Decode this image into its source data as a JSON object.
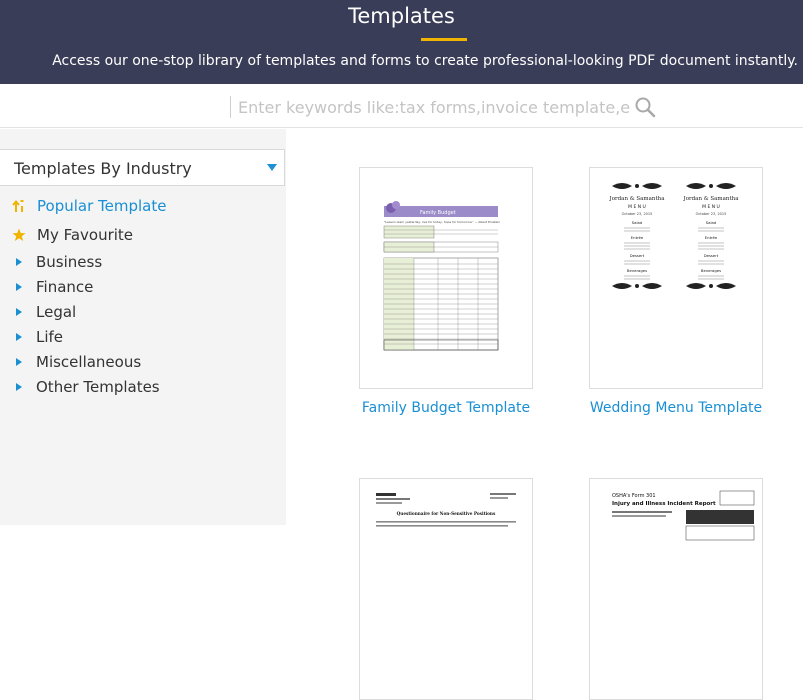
{
  "header": {
    "title": "Templates",
    "subtitle": "Access our one-stop library of templates and forms to create professional-looking PDF document instantly.",
    "accent_color": "#f0b400",
    "background_color": "#3a3d58"
  },
  "search": {
    "placeholder": "Enter keywords like:tax forms,invoice template,e...",
    "icon": "search-icon"
  },
  "sidebar": {
    "dropdown_label": "Templates By Industry",
    "items": [
      {
        "label": "Popular Template",
        "icon": "popular-sort-icon",
        "active": true
      },
      {
        "label": "My Favourite",
        "icon": "star-icon",
        "active": false
      },
      {
        "label": "Business",
        "icon": "triangle-right-icon",
        "active": false
      },
      {
        "label": "Finance",
        "icon": "triangle-right-icon",
        "active": false
      },
      {
        "label": "Legal",
        "icon": "triangle-right-icon",
        "active": false
      },
      {
        "label": "Life",
        "icon": "triangle-right-icon",
        "active": false
      },
      {
        "label": "Miscellaneous",
        "icon": "triangle-right-icon",
        "active": false
      },
      {
        "label": "Other Templates",
        "icon": "triangle-right-icon",
        "active": false
      }
    ]
  },
  "templates": [
    {
      "title": "Family Budget Template",
      "thumb": {
        "header": "Family Budget",
        "quote": "\"Lesson learn yesterday, live for today, hope for tomorrow.\" ~ Albert Einstein"
      }
    },
    {
      "title": "Wedding Menu Template",
      "thumb": {
        "names": "Jordan & Samantha",
        "menu": "M E N U",
        "date": "October 23, 2015",
        "courses": [
          "Salad",
          "Entrée",
          "Dessert",
          "Beverages"
        ]
      }
    },
    {
      "title": "",
      "thumb": {
        "heading": "Questionnaire for Non-Sensitive Positions"
      }
    },
    {
      "title": "",
      "thumb": {
        "heading": "OSHA's Form 301",
        "subheading": "Injury and Illness Incident Report"
      }
    }
  ],
  "colors": {
    "link": "#1a8fd3",
    "sidebar_bg": "#f4f4f4",
    "star": "#f0b400"
  }
}
